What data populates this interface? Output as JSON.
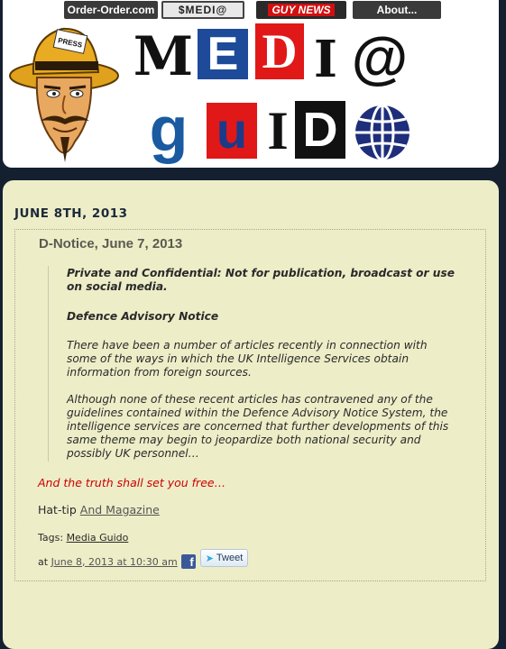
{
  "nav": {
    "order_order": "Order-Order.com",
    "media_guido": "$MEDI@",
    "guy_news": "GUY NEWS",
    "about": "About..."
  },
  "mascot": {
    "hat_label": "PRESS"
  },
  "logo": {
    "line1": [
      "M",
      "E",
      "D",
      "I",
      "@"
    ],
    "line2": [
      "G",
      "U",
      "I",
      "D",
      "#"
    ]
  },
  "post": {
    "date": "JUNE 8TH, 2013",
    "title": "D-Notice, June 7, 2013",
    "quote": {
      "p1": "Private and Confidential: Not for publication, broadcast or use on social media.",
      "p2": "Defence Advisory Notice",
      "p3": "There have been a number of articles recently in connection with some of the ways in which the UK Intelligence Services obtain information from foreign sources.",
      "p4": "Although none of these recent articles has contravened any of the guidelines contained within the Defence Advisory Notice System, the intelligence services are concerned that further developments of this same theme may begin to jeopardize both national security and possibly UK personnel…"
    },
    "truth": "And the truth shall set you free…",
    "hattip_prefix": "Hat-tip ",
    "hattip_link": "And Magazine",
    "tags_prefix": "Tags: ",
    "tag_link": "Media Guido",
    "at_prefix": "at ",
    "permalink": "June 8, 2013 at 10:30 am",
    "fb_icon": "f",
    "tweet_label": "Tweet"
  },
  "colors": {
    "page_bg": "#142030",
    "content_bg": "#ededc8",
    "accent_red": "#cc0000",
    "facebook_blue": "#3b5998"
  }
}
